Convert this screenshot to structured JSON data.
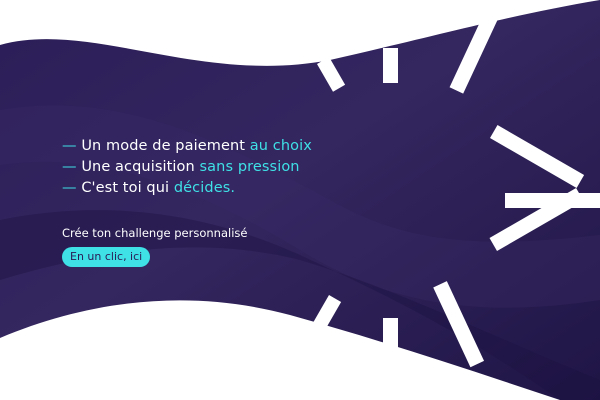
{
  "colors": {
    "background": "#ffffff",
    "banner_dark": "#22174a",
    "banner_mid": "#34265f",
    "accent": "#3fe0e6",
    "button_text": "#2a1b55"
  },
  "bullets": [
    {
      "dash": "—",
      "text": "Un mode de paiement",
      "highlight": "au choix"
    },
    {
      "dash": "—",
      "text": "Une acquisition",
      "highlight": "sans pression"
    },
    {
      "dash": "—",
      "text": "C'est toi qui",
      "highlight": "décides."
    }
  ],
  "cta": {
    "label": "Crée ton challenge personnalisé",
    "button_label": "En un clic, ici"
  },
  "decoration": {
    "icon": "sunburst-rays-icon"
  }
}
